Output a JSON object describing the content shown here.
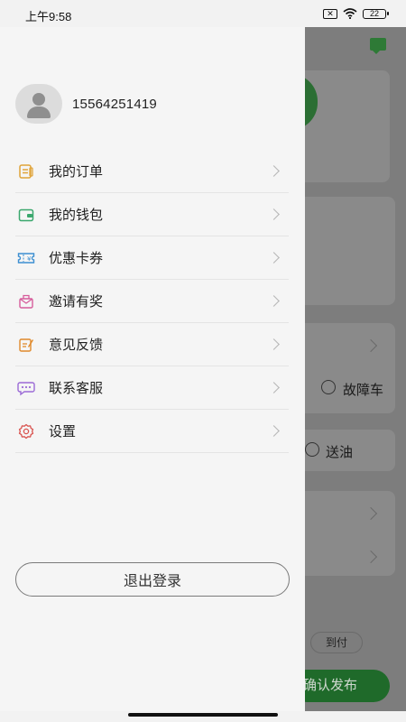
{
  "status_bar": {
    "time": "上午9:58",
    "battery": "22",
    "sim": "✕"
  },
  "profile": {
    "phone": "15564251419"
  },
  "menu": {
    "items": [
      {
        "label": "我的订单",
        "icon": "order-list-icon"
      },
      {
        "label": "我的钱包",
        "icon": "wallet-icon"
      },
      {
        "label": "优惠卡券",
        "icon": "coupon-icon"
      },
      {
        "label": "邀请有奖",
        "icon": "invite-reward-icon"
      },
      {
        "label": "意见反馈",
        "icon": "feedback-icon"
      },
      {
        "label": "联系客服",
        "icon": "chat-support-icon"
      },
      {
        "label": "设置",
        "icon": "settings-gear-icon"
      }
    ]
  },
  "logout_label": "退出登录",
  "background": {
    "option_fault_car": "故障车",
    "option_fuel": "送油",
    "chip_pay_on_arrival": "到付",
    "publish_button": "确认发布"
  },
  "colors": {
    "drawer_bg": "#f5f5f5",
    "overlay": "#7d7d7d",
    "order_icon": "#e0a43a",
    "wallet_icon": "#3aa76d",
    "coupon_icon": "#3d8fd1",
    "invite_icon": "#d65c9b",
    "feedback_icon": "#e08a2c",
    "chat_icon": "#9b6bd6",
    "settings_icon": "#d9534f",
    "brand_green": "#2e7a36"
  }
}
